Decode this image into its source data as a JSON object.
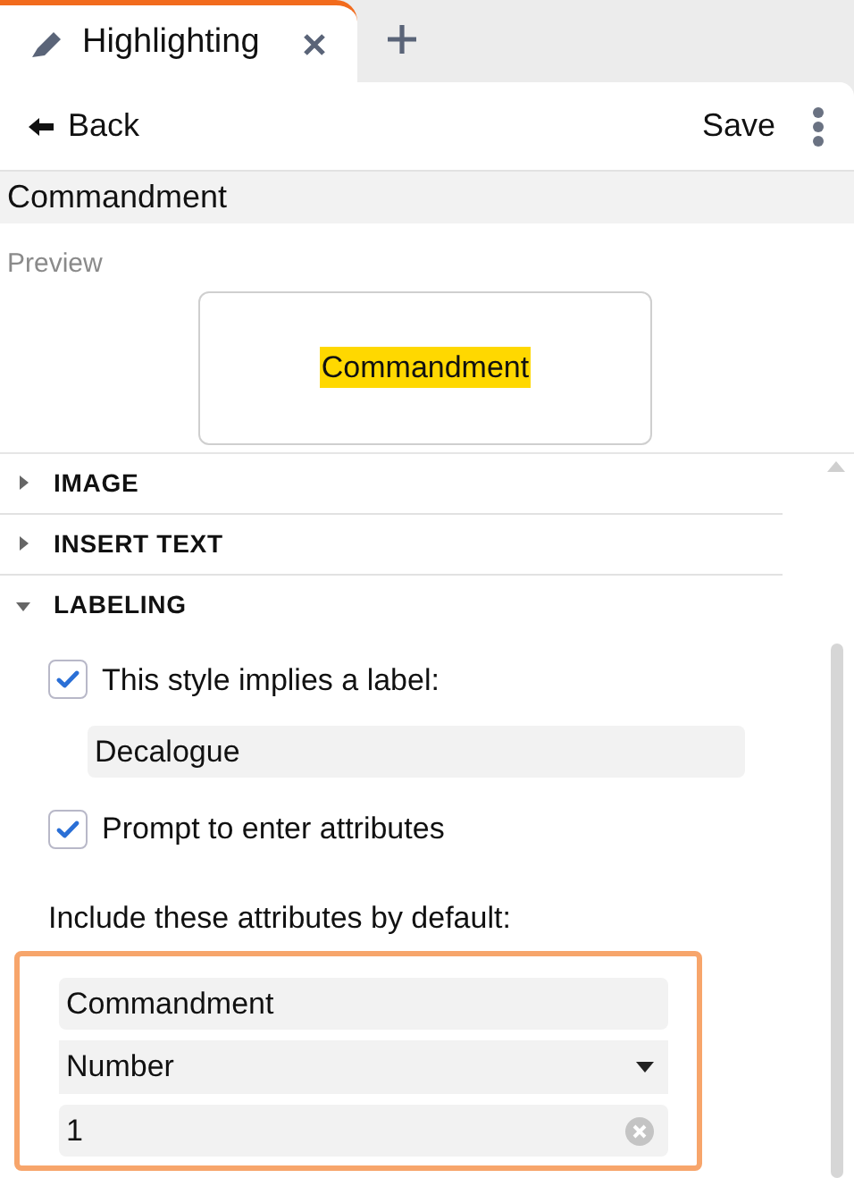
{
  "tabs": [
    {
      "label": "Highlighting",
      "selected": true
    }
  ],
  "toolbar": {
    "back": "Back",
    "save": "Save"
  },
  "style_name": "Commandment",
  "preview": {
    "label": "Preview",
    "sample": "Commandment"
  },
  "sections": [
    {
      "title": "IMAGE",
      "expanded": false
    },
    {
      "title": "INSERT TEXT",
      "expanded": false
    },
    {
      "title": "LABELING",
      "expanded": true
    }
  ],
  "labeling": {
    "implies_label": {
      "label": "This style implies a label:",
      "checked": true
    },
    "label_value": "Decalogue",
    "prompt_attributes": {
      "label": "Prompt to enter attributes",
      "checked": true
    },
    "defaults_heading": "Include these attributes by default:",
    "attribute_name": "Commandment",
    "attribute_type": "Number",
    "attribute_value": "1"
  }
}
